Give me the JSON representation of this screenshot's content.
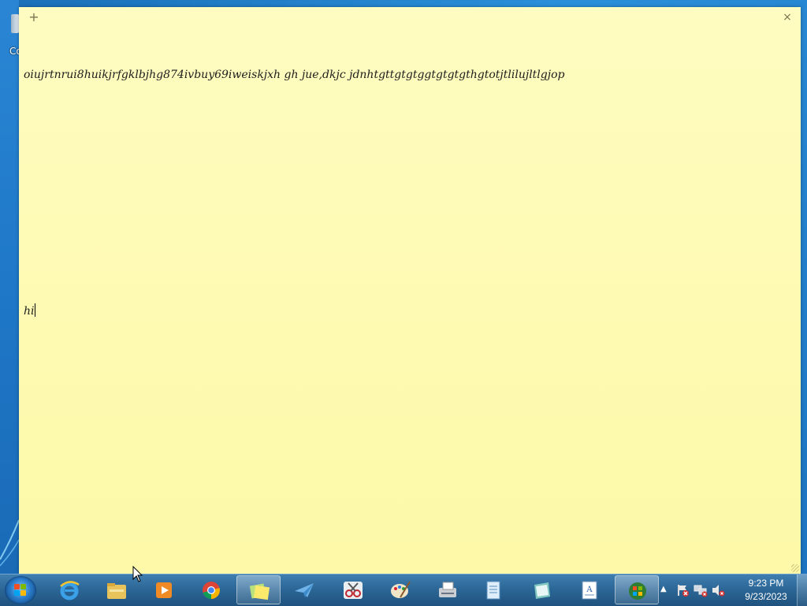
{
  "desktop": {
    "icon_label": "Co"
  },
  "sticky_note": {
    "add_glyph": "+",
    "close_glyph": "×",
    "background_color": "#fdf9a8",
    "lines": [
      "oiujrtnrui8huikjrfgklbjhg874ivbuy69iweiskjxh gh jue,dkjc jdnhtgttgtgtggtgtgtgthgtotjtlilujltlgjop",
      "",
      "",
      "",
      "",
      "hi"
    ]
  },
  "taskbar": {
    "start_icon": "windows-start-orb",
    "pinned": [
      {
        "name": "internet-explorer-icon"
      },
      {
        "name": "file-explorer-icon"
      },
      {
        "name": "media-player-icon"
      },
      {
        "name": "chrome-icon"
      },
      {
        "name": "sticky-notes-icon",
        "active": true
      },
      {
        "name": "paper-plane-icon"
      },
      {
        "name": "snipping-tool-icon"
      },
      {
        "name": "paint-icon"
      },
      {
        "name": "fax-scan-icon"
      },
      {
        "name": "notepad-icon"
      },
      {
        "name": "journal-icon"
      },
      {
        "name": "wordpad-icon"
      },
      {
        "name": "windows-update-icon"
      }
    ],
    "tray": {
      "show_hidden_glyph": "▲",
      "icons": [
        "action-center-icon",
        "network-icon",
        "volume-muted-icon"
      ],
      "time": "9:23 PM",
      "date": "9/23/2023"
    }
  }
}
